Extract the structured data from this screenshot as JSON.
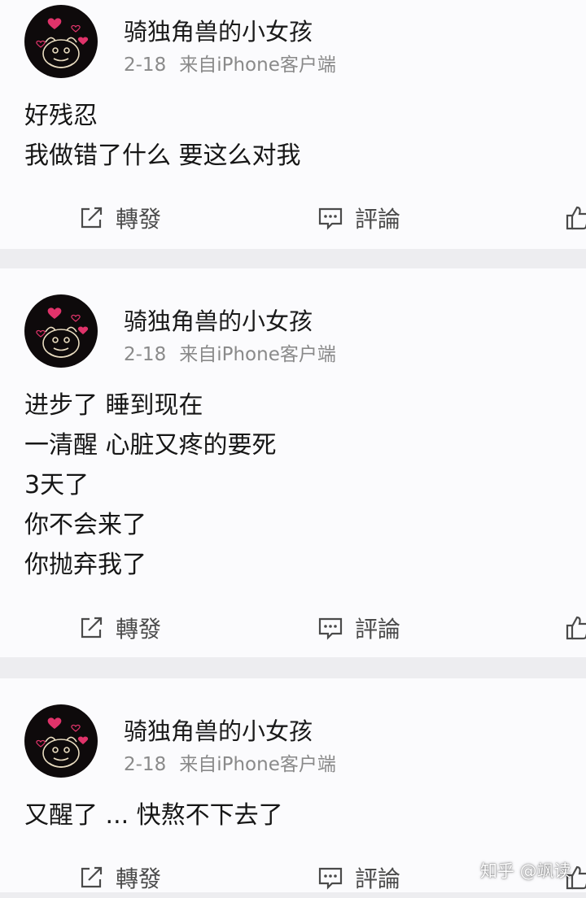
{
  "posts": [
    {
      "user": "骑独角兽的小女孩",
      "time": "2-18",
      "source": "来自iPhone客户端",
      "lines": [
        "好残忍",
        "我做错了什么 要这么对我"
      ],
      "repost_label": "轉發",
      "comment_label": "評論"
    },
    {
      "user": "骑独角兽的小女孩",
      "time": "2-18",
      "source": "来自iPhone客户端",
      "lines": [
        "进步了 睡到现在",
        "一清醒 心脏又疼的要死",
        "3天了",
        "你不会来了",
        "你抛弃我了"
      ],
      "repost_label": "轉發",
      "comment_label": "評論"
    },
    {
      "user": "骑独角兽的小女孩",
      "time": "2-18",
      "source": "来自iPhone客户端",
      "lines": [
        "又醒了 ... 快熬不下去了"
      ],
      "repost_label": "轉發",
      "comment_label": "評論"
    }
  ],
  "watermark": "知乎 @飒读",
  "icons": {
    "avatar": "avatar-bear-with-hearts",
    "repost": "repost-icon",
    "comment": "comment-icon",
    "like": "thumbs-up-icon"
  },
  "colors": {
    "background": "#ededf0",
    "card": "#fbfbfd",
    "meta_text": "#8a8a8a",
    "action_text": "#4a4a4a",
    "heart": "#e0336a"
  }
}
